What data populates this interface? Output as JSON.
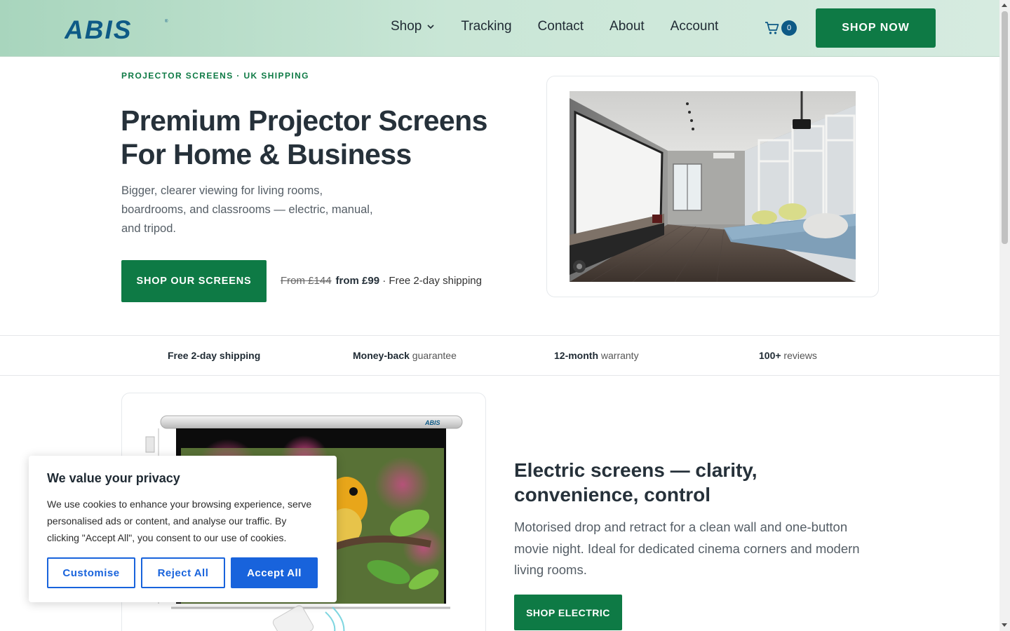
{
  "brand": {
    "logo_text": "ABIS",
    "accent": "#0e7a45",
    "logo_color": "#0e5a86"
  },
  "nav": {
    "items": [
      {
        "label": "Shop",
        "has_dropdown": true
      },
      {
        "label": "Tracking"
      },
      {
        "label": "Contact"
      },
      {
        "label": "About"
      },
      {
        "label": "Account"
      }
    ],
    "cart_count": "0",
    "cta_label": "SHOP NOW"
  },
  "hero": {
    "eyebrow": "PROJECTOR SCREENS · UK SHIPPING",
    "title": "Premium Projector Screens For Home & Business",
    "subtitle": "Bigger, clearer viewing for living rooms, boardrooms, and classrooms — electric, manual, and tripod.",
    "cta_label": "SHOP OUR SCREENS",
    "price_old": "From £144",
    "price_new": "from £99",
    "price_note": " · Free 2-day shipping"
  },
  "features": [
    {
      "bold": "Free 2-day shipping",
      "rest": ""
    },
    {
      "bold": "Money-back",
      "rest": " guarantee"
    },
    {
      "bold": "12-month",
      "rest": " warranty"
    },
    {
      "bold": "100+",
      "rest": " reviews"
    }
  ],
  "electric": {
    "product_logo": "ABIS",
    "title": "Electric screens — clarity, convenience, control",
    "subtitle": "Motorised drop and retract for a clean wall and one-button movie night. Ideal for dedicated cinema corners and modern living rooms.",
    "cta_label": "SHOP ELECTRIC"
  },
  "cookie": {
    "title": "We value your privacy",
    "body": "We use cookies to enhance your browsing experience, serve personalised ads or content, and analyse our traffic. By clicking \"Accept All\", you consent to our use of cookies.",
    "customise": "Customise",
    "reject": "Reject All",
    "accept": "Accept All",
    "accent": "#1863dc"
  }
}
